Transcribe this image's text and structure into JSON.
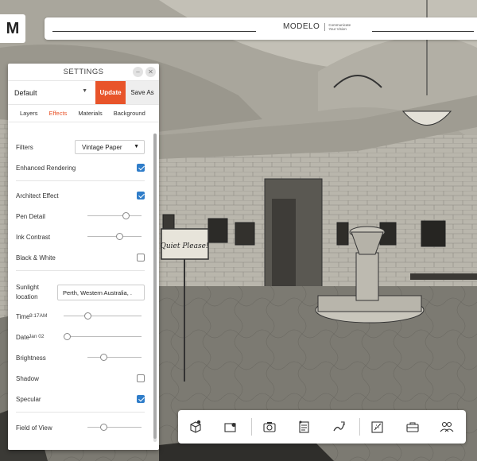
{
  "app": {
    "logo_letter": "M",
    "brand_name": "MODELO",
    "brand_tagline": "Communicate Your Vision"
  },
  "scene": {
    "sign_text": "Quiet Please!"
  },
  "settings": {
    "title": "SETTINGS",
    "preset": "Default",
    "update_label": "Update",
    "save_as_label": "Save As",
    "tabs": [
      {
        "label": "Layers",
        "active": false
      },
      {
        "label": "Effects",
        "active": true
      },
      {
        "label": "Materials",
        "active": false
      },
      {
        "label": "Background",
        "active": false
      }
    ],
    "filters": {
      "label": "Filters",
      "value": "Vintage Paper"
    },
    "enhanced_rendering": {
      "label": "Enhanced Rendering",
      "checked": true
    },
    "architect_effect": {
      "label": "Architect Effect",
      "checked": true
    },
    "pen_detail": {
      "label": "Pen Detail",
      "level": 0.75
    },
    "ink_contrast": {
      "label": "Ink Contrast",
      "level": 0.6
    },
    "black_white": {
      "label": "Black & White",
      "checked": false
    },
    "sunlight_location": {
      "label": "Sunlight location",
      "value": "Perth, Western Australia, ."
    },
    "time": {
      "label": "Time",
      "value": "9:17AM",
      "level": 0.3
    },
    "date": {
      "label": "Date",
      "value": "Jan 02",
      "level": 0.0
    },
    "brightness": {
      "label": "Brightness",
      "level": 0.32
    },
    "shadow": {
      "label": "Shadow",
      "checked": false
    },
    "specular": {
      "label": "Specular",
      "checked": true
    },
    "field_of_view": {
      "label": "Field of View",
      "level": 0.3
    }
  },
  "toolbar": {
    "tools": [
      "cube-eye-icon",
      "map-pin-icon",
      "camera-icon",
      "notes-icon",
      "pen-icon",
      "effects-icon",
      "briefcase-icon",
      "users-icon"
    ]
  },
  "colors": {
    "accent": "#e8542a",
    "check": "#2f7dc9"
  }
}
